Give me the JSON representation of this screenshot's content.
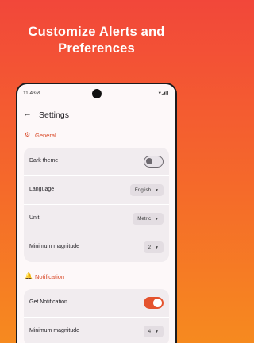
{
  "hero": {
    "line1": "Customize Alerts and",
    "line2": "Preferences"
  },
  "status_bar": {
    "time": "11:43",
    "alarm_icon": "alarm-off-icon",
    "right_icons": "▾◢▮"
  },
  "app_bar": {
    "back_glyph": "←",
    "title": "Settings"
  },
  "general": {
    "header": "General",
    "icon": "gear-icon",
    "rows": {
      "dark_theme": {
        "label": "Dark theme",
        "enabled": false
      },
      "language": {
        "label": "Language",
        "value": "English"
      },
      "unit": {
        "label": "Unit",
        "value": "Metric"
      },
      "min_magnitude": {
        "label": "Minimum magnitude",
        "value": "2"
      }
    }
  },
  "notification": {
    "header": "Notification",
    "icon": "bell-icon",
    "rows": {
      "get_notification": {
        "label": "Get Notification",
        "enabled": true
      },
      "min_magnitude": {
        "label": "Minimum magnitude",
        "value": "4"
      }
    }
  },
  "colors": {
    "accent": "#e4532e",
    "section_header": "#d94b2a",
    "card_bg": "#f1ecef",
    "gradient_top": "#f2473a",
    "gradient_bottom": "#f68a1f"
  }
}
